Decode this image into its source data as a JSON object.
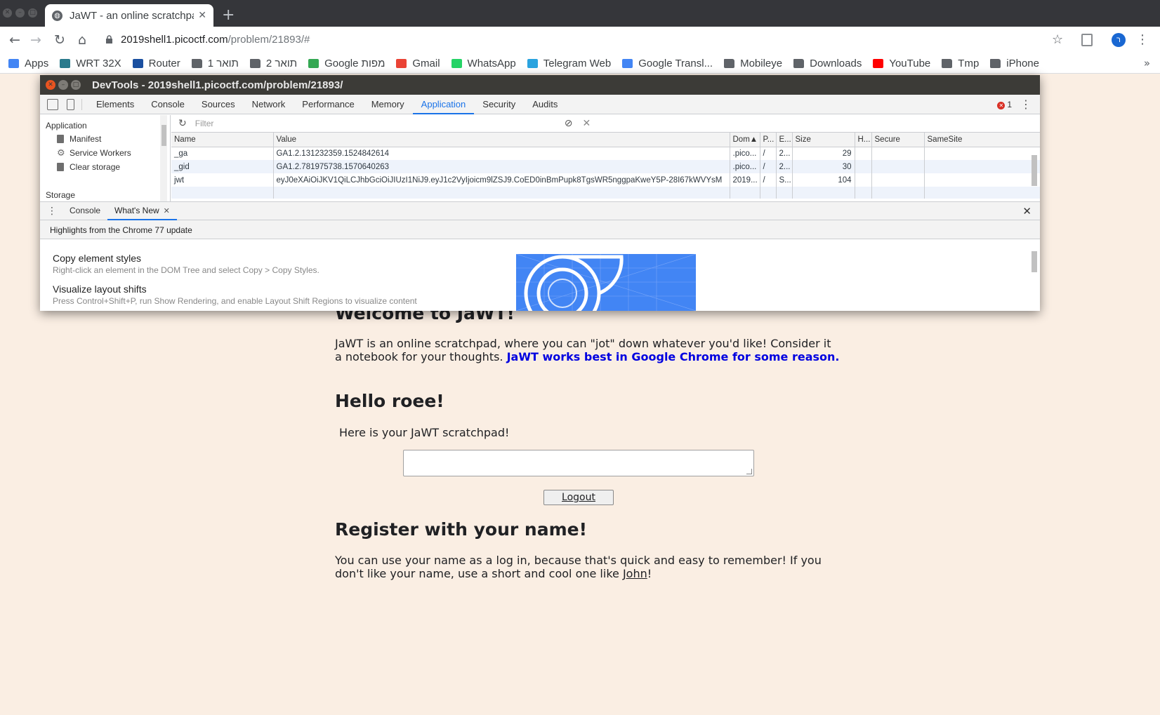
{
  "browser": {
    "tab_title": "JaWT - an online scratchpad",
    "url_host": "2019shell1.picoctf.com",
    "url_path": "/problem/21893/#",
    "profile_initial": "ר"
  },
  "bookmarks": [
    {
      "label": "Apps",
      "icon": "apps-grid-icon",
      "color": "#4285f4"
    },
    {
      "label": "WRT 32X",
      "icon": "wifi-icon",
      "color": "#2a7a8c"
    },
    {
      "label": "Router",
      "icon": "b-logo-icon",
      "color": "#1a4fa0"
    },
    {
      "label": "תואר 1",
      "icon": "folder-icon",
      "color": "#5f6368"
    },
    {
      "label": "תואר 2",
      "icon": "folder-icon",
      "color": "#5f6368"
    },
    {
      "label": "Google מפות",
      "icon": "maps-icon",
      "color": "#34a853"
    },
    {
      "label": "Gmail",
      "icon": "gmail-icon",
      "color": "#ea4335"
    },
    {
      "label": "WhatsApp",
      "icon": "whatsapp-icon",
      "color": "#25d366"
    },
    {
      "label": "Telegram Web",
      "icon": "telegram-icon",
      "color": "#2aa3df"
    },
    {
      "label": "Google Transl...",
      "icon": "translate-icon",
      "color": "#4285f4"
    },
    {
      "label": "Mobileye",
      "icon": "folder-icon",
      "color": "#5f6368"
    },
    {
      "label": "Downloads",
      "icon": "folder-icon",
      "color": "#5f6368"
    },
    {
      "label": "YouTube",
      "icon": "youtube-icon",
      "color": "#ff0000"
    },
    {
      "label": "Tmp",
      "icon": "folder-icon",
      "color": "#5f6368"
    },
    {
      "label": "iPhone",
      "icon": "folder-icon",
      "color": "#5f6368"
    }
  ],
  "devtools": {
    "title": "DevTools - 2019shell1.picoctf.com/problem/21893/",
    "tabs": [
      "Elements",
      "Console",
      "Sources",
      "Network",
      "Performance",
      "Memory",
      "Application",
      "Security",
      "Audits"
    ],
    "active_tab": "Application",
    "error_count": "1",
    "sidebar": {
      "section": "Application",
      "items": [
        "Manifest",
        "Service Workers",
        "Clear storage"
      ],
      "storage_label": "Storage"
    },
    "filter_placeholder": "Filter",
    "cookie_columns": [
      "Name",
      "Value",
      "Dom▲",
      "P...",
      "E...",
      "Size",
      "H...",
      "Secure",
      "SameSite"
    ],
    "cookies": [
      {
        "name": "_ga",
        "value": "GA1.2.131232359.1524842614",
        "domain": ".pico...",
        "path": "/",
        "expires": "2...",
        "size": "29"
      },
      {
        "name": "_gid",
        "value": "GA1.2.781975738.1570640263",
        "domain": ".pico...",
        "path": "/",
        "expires": "2...",
        "size": "30"
      },
      {
        "name": "jwt",
        "value": "eyJ0eXAiOiJKV1QiLCJhbGciOiJIUzI1NiJ9.eyJ1c2VyIjoicm9lZSJ9.CoED0inBmPupk8TgsWR5nggpaKweY5P-28I67kWVYsM",
        "domain": "2019...",
        "path": "/",
        "expires": "S...",
        "size": "104"
      }
    ],
    "drawer": {
      "tabs": [
        "Console",
        "What's New"
      ],
      "active": "What's New",
      "highlight": "Highlights from the Chrome 77 update",
      "items": [
        {
          "title": "Copy element styles",
          "desc": "Right-click an element in the DOM Tree and select Copy > Copy Styles."
        },
        {
          "title": "Visualize layout shifts",
          "desc": "Press Control+Shift+P, run Show Rendering, and enable Layout Shift Regions to visualize content"
        }
      ]
    }
  },
  "page": {
    "welcome": "Welcome to JaWT!",
    "intro": " JaWT is an online scratchpad, where you can \"jot\" down whatever you'd like! Consider it a notebook for your thoughts. ",
    "intro_highlight": "JaWT works best in Google Chrome for some reason.",
    "hello": "Hello roee!",
    "scratchpad_label": " Here is your JaWT scratchpad!",
    "logout": "Logout",
    "register_heading": "Register with your name!",
    "register_text": " You can use your name as a log in, because that's quick and easy to remember! If you don't like your name, use a short and cool one like ",
    "register_link": "John",
    "register_end": "!"
  }
}
